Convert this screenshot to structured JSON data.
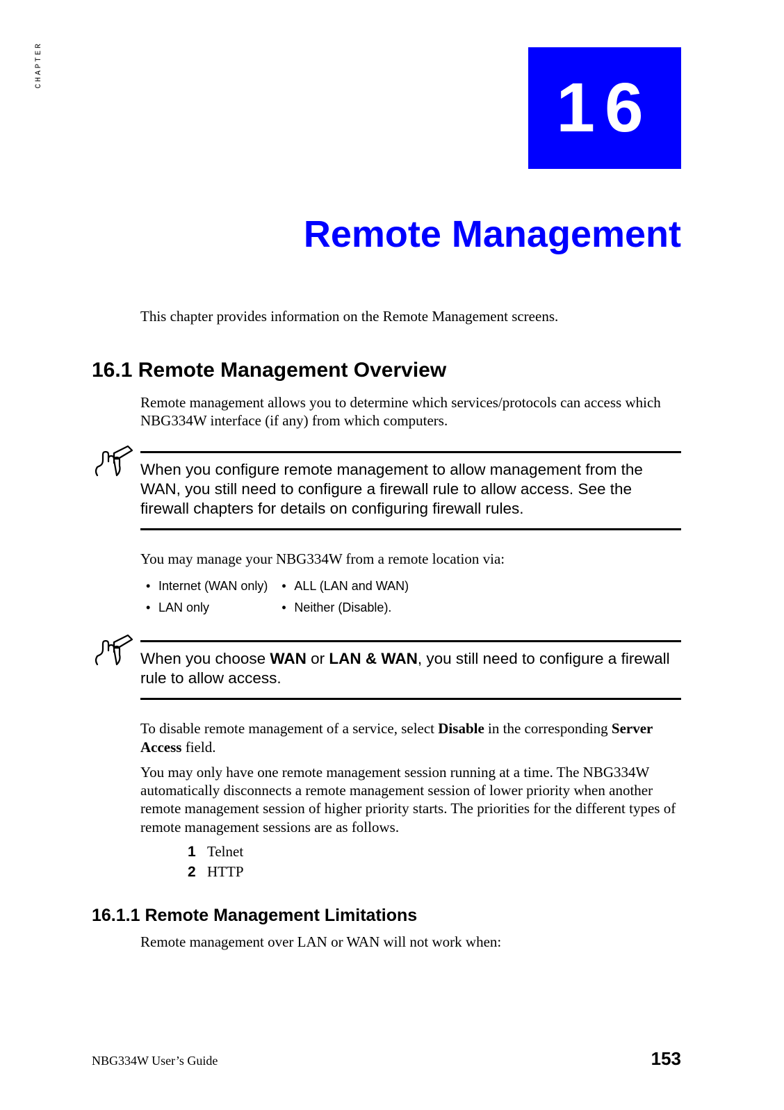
{
  "chapter": {
    "badge": "CHAPTER",
    "number": "16",
    "title": "Remote Management"
  },
  "intro": "This chapter provides information on the Remote Management screens.",
  "section1": {
    "heading": "16.1  Remote Management Overview",
    "p1": "Remote management allows you to determine which services/protocols can access which NBG334W interface (if any) from which computers."
  },
  "note1": "When you configure remote management to allow management from the WAN, you still need to configure a firewall rule to allow access. See the firewall chapters for details on configuring firewall rules.",
  "lead2": "You may manage your NBG334W from a remote location via:",
  "options": {
    "r1c1": "Internet (WAN only)",
    "r1c2": "ALL (LAN and WAN)",
    "r2c1": "LAN only",
    "r2c2": "Neither (Disable)."
  },
  "note2": {
    "pre": "When you choose ",
    "b1": "WAN",
    "mid": " or ",
    "b2": "LAN & WAN",
    "post": ", you still need to configure a firewall rule to allow access."
  },
  "para_disable": {
    "pre": "To disable remote management of a service, select ",
    "b1": "Disable",
    "mid": " in the corresponding ",
    "b2": "Server Access",
    "post": " field."
  },
  "para_session": "You may only have one remote management session running at a time. The NBG334W automatically disconnects a remote management session of lower priority when another remote management session of higher priority starts. The priorities for the different types of remote management sessions are as follows.",
  "priority_list": {
    "i1": "Telnet",
    "i2": "HTTP"
  },
  "section2": {
    "heading": "16.1.1  Remote Management Limitations",
    "p1": "Remote management over LAN or WAN will not work when:"
  },
  "footer": {
    "left": "NBG334W User’s Guide",
    "right": "153"
  }
}
